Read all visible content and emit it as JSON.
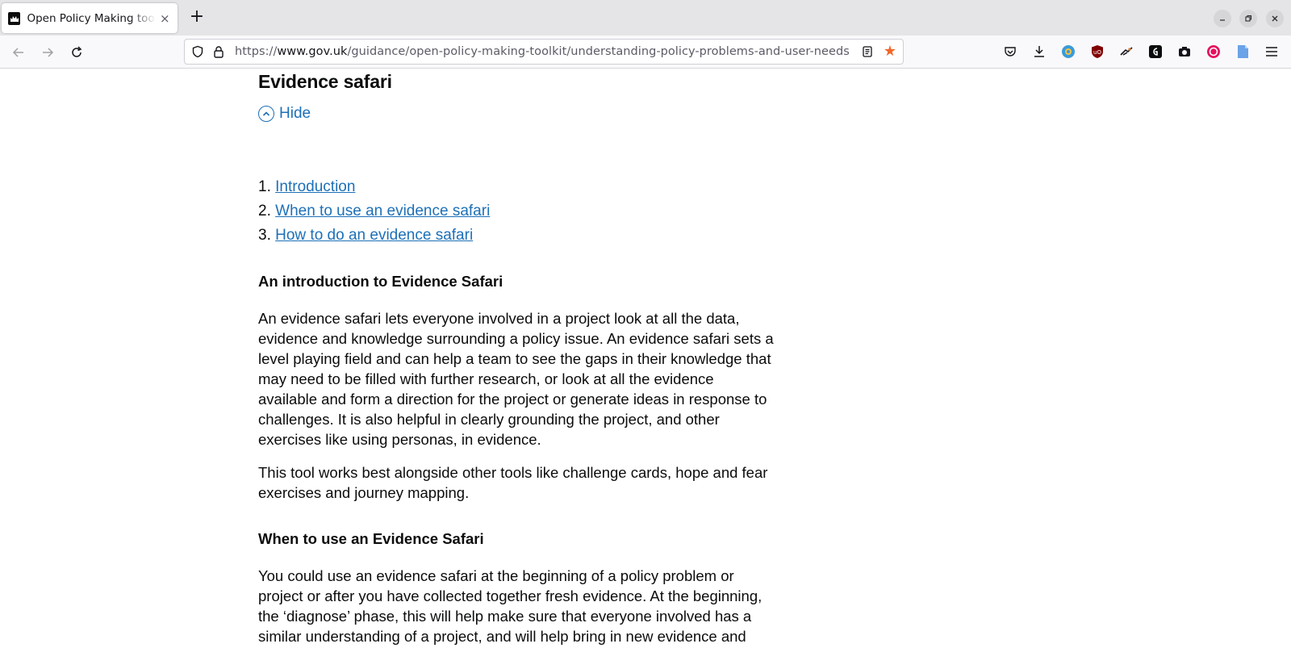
{
  "browser": {
    "tab_title": "Open Policy Making toolkit",
    "tab_close": "×",
    "new_tab": "+",
    "url_scheme": "https://",
    "url_host": "www.gov.uk",
    "url_path": "/guidance/open-policy-making-toolkit/understanding-policy-problems-and-user-needs",
    "accent_color": "#f06628"
  },
  "page": {
    "section_title": "Evidence safari",
    "hide_label": "Hide",
    "toc": [
      {
        "num": "1.",
        "label": "Introduction"
      },
      {
        "num": "2.",
        "label": "When to use an evidence safari"
      },
      {
        "num": "3.",
        "label": "How to do an evidence safari"
      }
    ],
    "intro_heading": "An introduction to Evidence Safari",
    "intro_p1": "An evidence safari lets everyone involved in a project look at all the data, evidence and knowledge surrounding a policy issue. An evidence safari sets a level playing field and can help a team to see the gaps in their knowledge that may need to be filled with further research, or look at all the evidence available and form a direction for the project or generate ideas in response to challenges. It is also helpful in clearly grounding the project, and other exercises like using personas, in evidence.",
    "intro_p2": "This tool works best alongside other tools like challenge cards, hope and fear exercises and journey mapping.",
    "when_heading": "When to use an Evidence Safari",
    "when_p1": "You could use an evidence safari at the beginning of a policy problem or project or after you have collected together fresh evidence. At the beginning, the ‘diagnose’ phase, this will help make sure that everyone involved has a similar understanding of a project, and will help bring in new evidence and",
    "link_color": "#1d70b8"
  }
}
